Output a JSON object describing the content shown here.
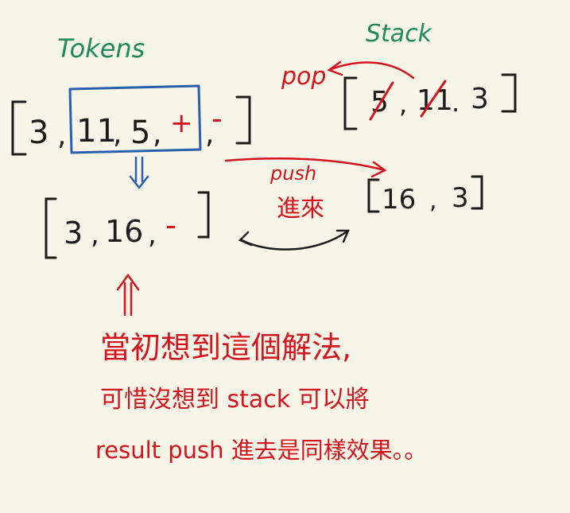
{
  "colors": {
    "paper": "#f7f4e8",
    "ink": "#1c1c1c",
    "green": "#1f8a5a",
    "red": "#d4141c",
    "blue": "#2a5fae"
  },
  "labels": {
    "tokens": "Tokens",
    "stack": "Stack",
    "pop": "pop",
    "push": "push",
    "push_cn": "進來",
    "result_hint": [
      "當初想到這個解法,",
      "可惜沒想到 stack 可以將",
      "result push 進去是同樣效果。。"
    ]
  },
  "tokens_before": {
    "items": [
      "3",
      "11",
      "5",
      "+",
      "-"
    ],
    "highlighted_range": [
      1,
      3
    ],
    "operator": "+"
  },
  "tokens_after": {
    "items": [
      "3",
      "16",
      "-"
    ]
  },
  "stack_before": {
    "items": [
      "5",
      "11",
      "3"
    ],
    "crossed": [
      "5",
      "11"
    ]
  },
  "stack_after": {
    "items": [
      "16",
      "3"
    ]
  },
  "icons": {
    "down_arrow": "double-down-arrow-icon",
    "up_arrow": "double-up-arrow-icon",
    "swap_arrow": "double-headed-arrow-icon"
  }
}
